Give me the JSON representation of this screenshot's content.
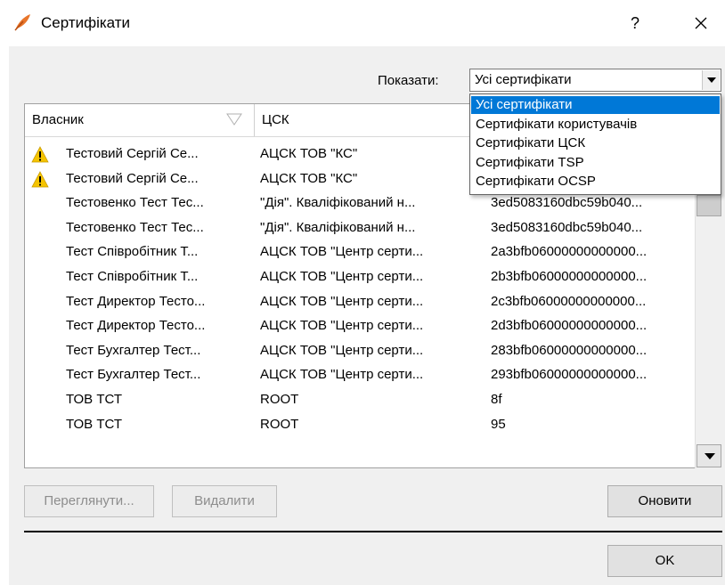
{
  "window": {
    "title": "Сертифікати",
    "help_label": "?"
  },
  "filter": {
    "label": "Показати:",
    "selected": "Усі сертифікати",
    "options": [
      "Усі сертифікати",
      "Сертифікати користувачів",
      "Сертифікати ЦСК",
      "Сертифікати TSP",
      "Сертифікати OCSP"
    ]
  },
  "table": {
    "columns": [
      "Власник",
      "ЦСК"
    ],
    "rows": [
      {
        "owner": "Тестовий Сергій Се...",
        "ca": "АЦСК ТОВ \"КС\"",
        "serial": "",
        "warning": true
      },
      {
        "owner": "Тестовий Сергій Се...",
        "ca": "АЦСК ТОВ \"КС\"",
        "serial": "",
        "warning": true
      },
      {
        "owner": "Тестовенко Тест Тес...",
        "ca": "\"Дія\". Кваліфікований н...",
        "serial": "3ed5083160dbc59b040...",
        "warning": false
      },
      {
        "owner": "Тестовенко Тест Тес...",
        "ca": "\"Дія\". Кваліфікований н...",
        "serial": "3ed5083160dbc59b040...",
        "warning": false
      },
      {
        "owner": "Тест Співробітник Т...",
        "ca": "АЦСК ТОВ \"Центр серти...",
        "serial": "2a3bfb06000000000000...",
        "warning": false
      },
      {
        "owner": "Тест Співробітник Т...",
        "ca": "АЦСК ТОВ \"Центр серти...",
        "serial": "2b3bfb06000000000000...",
        "warning": false
      },
      {
        "owner": "Тест Директор Тесто...",
        "ca": "АЦСК ТОВ \"Центр серти...",
        "serial": "2c3bfb06000000000000...",
        "warning": false
      },
      {
        "owner": "Тест Директор Тесто...",
        "ca": "АЦСК ТОВ \"Центр серти...",
        "serial": "2d3bfb06000000000000...",
        "warning": false
      },
      {
        "owner": "Тест Бухгалтер Тест...",
        "ca": "АЦСК ТОВ \"Центр серти...",
        "serial": "283bfb06000000000000...",
        "warning": false
      },
      {
        "owner": "Тест Бухгалтер Тест...",
        "ca": "АЦСК ТОВ \"Центр серти...",
        "serial": "293bfb06000000000000...",
        "warning": false
      },
      {
        "owner": "ТОВ ТСТ",
        "ca": "ROOT",
        "serial": "8f",
        "warning": false
      },
      {
        "owner": "ТОВ ТСТ",
        "ca": "ROOT",
        "serial": "95",
        "warning": false
      }
    ]
  },
  "buttons": {
    "view": "Переглянути...",
    "delete": "Видалити",
    "refresh": "Оновити",
    "ok": "OK"
  },
  "colors": {
    "selection": "#0078d7",
    "warning": "#f5c400",
    "app_icon": "#e8752a"
  }
}
